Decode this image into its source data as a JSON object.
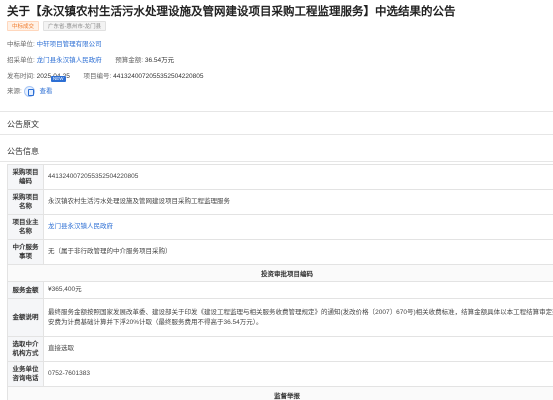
{
  "title": "关于【永汉镇农村生活污水处理设施及管网建设项目采购工程监理服务】中选结果的公告",
  "tags": [
    "中标成交",
    "广东省-惠州市-龙门县"
  ],
  "meta": {
    "winner_label": "中标单位:",
    "winner_value": "中轩项目管理有限公司",
    "buyer_label": "招采单位:",
    "buyer_value": "龙门县永汉镇人民政府",
    "budget_label": "预算金额:",
    "budget_value": "36.54万元",
    "publish_label": "发布时间:",
    "publish_value": "2025-04-25",
    "project_no_label": "项目编号:",
    "project_no_value": "441324007205535250422080​5",
    "new_badge": "NEW",
    "source_label": "来源:",
    "source_link": "查看"
  },
  "sections": {
    "body_heading": "公告原文",
    "info_heading": "公告信息"
  },
  "table": {
    "rows": [
      {
        "key": "采购项目编码",
        "value": "44132400720553525042208​05"
      },
      {
        "key": "采购项目名称",
        "value": "永汉镇农村生活污水处理设施及管网建设项目采购工程监理服务"
      },
      {
        "key": "项目业主名称",
        "value": "龙门县永汉镇人民政府"
      },
      {
        "key": "中介服务事项",
        "value": "无（属于非行政管理的中介服务项目采购）"
      }
    ],
    "section1_title": "投资审批项目编码",
    "rows2": [
      {
        "key": "服务金额",
        "value": "¥365,400元"
      },
      {
        "key": "金额说明",
        "value": "最终服务金额按照国家发展改革委、建设部关于印发《建设工程监理与相关服务收费管理规定》的通知(发改价格〔2007〕670号)相关收费标准，结算金额具体以本工程结算审定建安费为计费基础计算并下浮20%计取（最终服务费用不得高于36.54万元）。"
      },
      {
        "key": "选取中介机构方式",
        "value": "直接选取"
      },
      {
        "key": "业务单位咨询电话",
        "value": "0752-7601383"
      }
    ],
    "section2_title": "监督举报"
  }
}
